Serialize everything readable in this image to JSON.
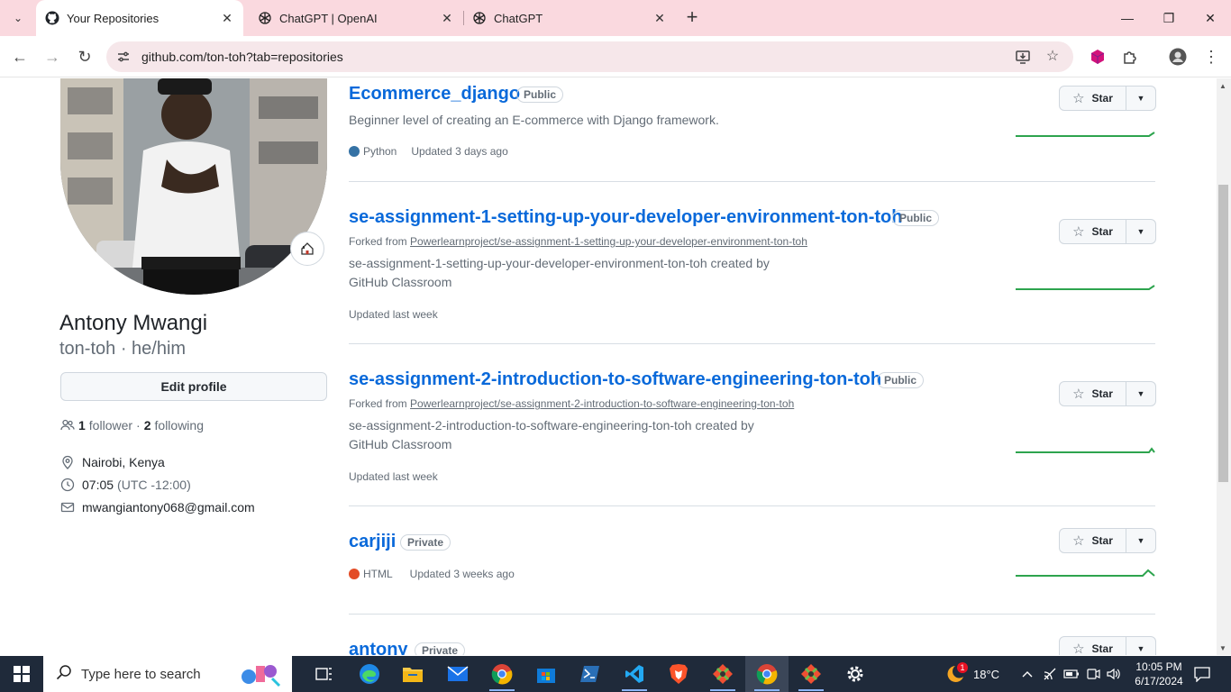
{
  "browser": {
    "tabs": [
      {
        "title": "Your Repositories",
        "icon": "github-icon",
        "active": true
      },
      {
        "title": "ChatGPT | OpenAI",
        "icon": "openai-icon",
        "active": false
      },
      {
        "title": "ChatGPT",
        "icon": "openai-icon",
        "active": false
      }
    ],
    "url": "github.com/ton-toh?tab=repositories"
  },
  "profile": {
    "full_name": "Antony Mwangi",
    "login_pronouns": "ton-toh · he/him",
    "edit_label": "Edit profile",
    "followers_count": "1",
    "followers_label": "follower",
    "separator": "·",
    "following_count": "2",
    "following_label": "following",
    "location": "Nairobi, Kenya",
    "time": "07:05",
    "timezone": "(UTC -12:00)",
    "email": "mwangiantony068@gmail.com"
  },
  "repos": [
    {
      "name": "Ecommerce_django",
      "visibility": "Public",
      "forked_prefix": "",
      "forked_from": "",
      "description": "Beginner level of creating an E-commerce with Django framework.",
      "description_line2": "",
      "language": "Python",
      "language_color": "#3572A5",
      "updated": "Updated 3 days ago",
      "star_label": "Star"
    },
    {
      "name": "se-assignment-1-setting-up-your-developer-environment-ton-toh",
      "visibility": "Public",
      "forked_prefix": "Forked from",
      "forked_from": "Powerlearnproject/se-assignment-1-setting-up-your-developer-environment-ton-toh",
      "description": "se-assignment-1-setting-up-your-developer-environment-ton-toh created by",
      "description_line2": "GitHub Classroom",
      "language": "",
      "language_color": "",
      "updated": "Updated last week",
      "star_label": "Star"
    },
    {
      "name": "se-assignment-2-introduction-to-software-engineering-ton-toh",
      "visibility": "Public",
      "forked_prefix": "Forked from",
      "forked_from": "Powerlearnproject/se-assignment-2-introduction-to-software-engineering-ton-toh",
      "description": "se-assignment-2-introduction-to-software-engineering-ton-toh created by",
      "description_line2": "GitHub Classroom",
      "language": "",
      "language_color": "",
      "updated": "Updated last week",
      "star_label": "Star"
    },
    {
      "name": "carjiji",
      "visibility": "Private",
      "forked_prefix": "",
      "forked_from": "",
      "description": "",
      "description_line2": "",
      "language": "HTML",
      "language_color": "#e34c26",
      "updated": "Updated 3 weeks ago",
      "star_label": "Star"
    },
    {
      "name": "antony",
      "visibility": "Private",
      "forked_prefix": "",
      "forked_from": "",
      "description": "",
      "description_line2": "",
      "language": "",
      "language_color": "",
      "updated": "",
      "star_label": "Star"
    }
  ],
  "taskbar": {
    "search_placeholder": "Type here to search",
    "weather_badge": "1",
    "temperature": "18°C",
    "time": "10:05 PM",
    "date": "6/17/2024"
  },
  "colors": {
    "link": "#0969da",
    "tabbar": "#fad9df",
    "spark": "#2da44e"
  }
}
